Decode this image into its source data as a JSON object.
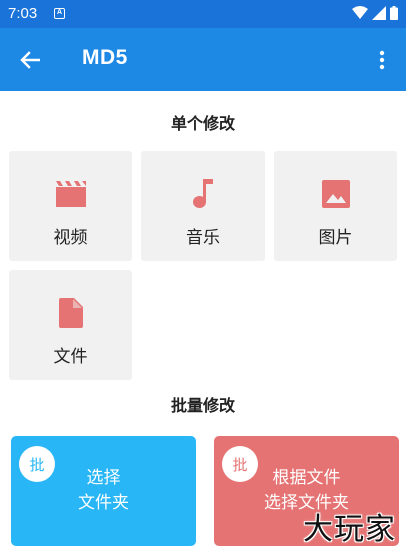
{
  "status_bar": {
    "time": "7:03",
    "notification_letter": "A"
  },
  "app_bar": {
    "title": "MD5"
  },
  "single_section": {
    "title": "单个修改",
    "tiles": [
      {
        "label": "视频",
        "icon": "movie-icon"
      },
      {
        "label": "音乐",
        "icon": "music-note-icon"
      },
      {
        "label": "图片",
        "icon": "image-icon"
      },
      {
        "label": "文件",
        "icon": "file-icon"
      }
    ]
  },
  "batch_section": {
    "title": "批量修改",
    "cards": [
      {
        "badge": "批",
        "line1": "选择",
        "line2": "文件夹",
        "color": "#29b6f6"
      },
      {
        "badge": "批",
        "line1": "根据文件",
        "line2": "选择文件夹",
        "color": "#e57373"
      }
    ]
  },
  "watermark": "大玩家",
  "colors": {
    "status_bar": "#1a73d9",
    "app_bar": "#1e88e5",
    "icon_accent": "#e57373",
    "tile_bg": "#f1f1f1"
  }
}
